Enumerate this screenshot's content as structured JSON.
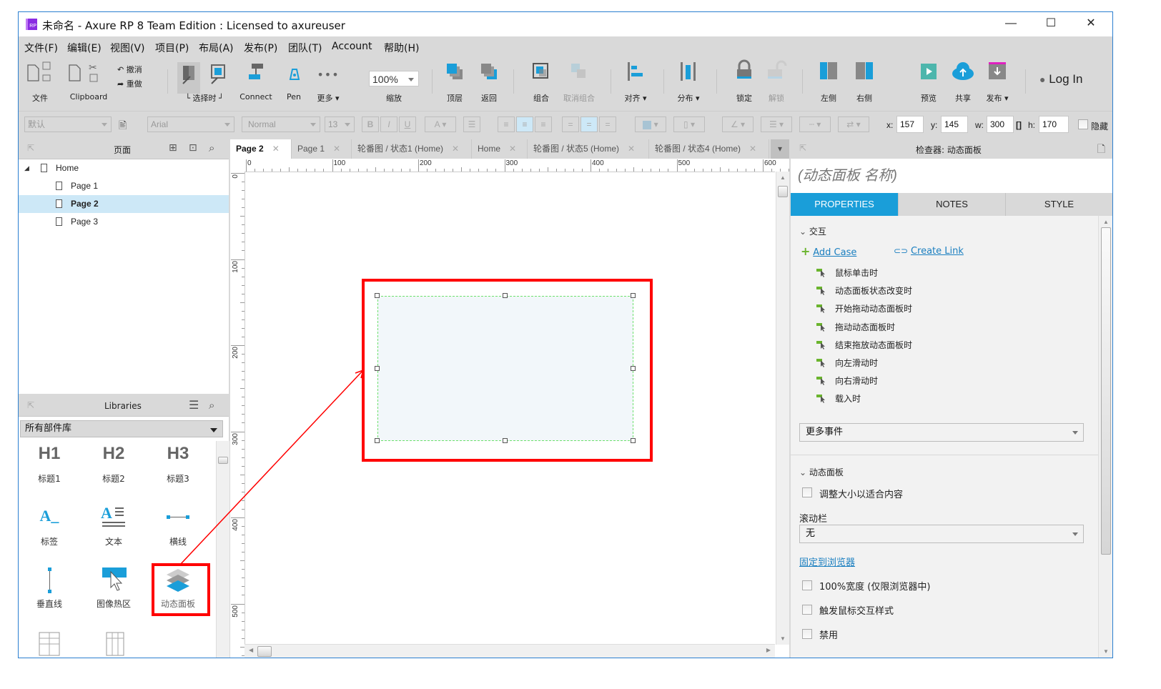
{
  "window": {
    "title": "未命名 - Axure RP 8 Team Edition : Licensed to axureuser",
    "app_icon_text": "RP",
    "controls": [
      "—",
      "☐",
      "✕"
    ]
  },
  "menu": [
    "文件(F)",
    "编辑(E)",
    "视图(V)",
    "项目(P)",
    "布局(A)",
    "发布(P)",
    "团队(T)",
    "Account",
    "帮助(H)"
  ],
  "toolbar": {
    "file_label": "文件",
    "clipboard_label": "Clipboard",
    "undo_label": "撤消",
    "redo_label": "重做",
    "select_mode_label": "└ 选择时 ┘",
    "connect_label": "Connect",
    "pen_label": "Pen",
    "more_label": "更多 ▾",
    "zoom_value": "100%",
    "zoom_label": "缩放",
    "top_label": "顶层",
    "back_label": "返回",
    "group_label": "组合",
    "ungroup_label": "取消组合",
    "align_label": "对齐 ▾",
    "distribute_label": "分布 ▾",
    "lock_label": "锁定",
    "unlock_label": "解锁",
    "left_label": "左侧",
    "right_label": "右侧",
    "preview_label": "预览",
    "share_label": "共享",
    "publish_label": "发布 ▾",
    "login_label": "Log In"
  },
  "format": {
    "style": "默认",
    "font": "Arial",
    "weight": "Normal",
    "size": "13",
    "bold": "B",
    "italic": "I",
    "underline": "U",
    "x_label": "x:",
    "x": "157",
    "y_label": "y:",
    "y": "145",
    "w_label": "w:",
    "w": "300",
    "h_label": "h:",
    "h": "170",
    "hidden_label": "隐藏"
  },
  "pages_panel": {
    "title": "页面",
    "items": [
      {
        "label": "Home"
      },
      {
        "label": "Page 1"
      },
      {
        "label": "Page 2"
      },
      {
        "label": "Page 3"
      }
    ],
    "selected": "Page 2"
  },
  "libraries": {
    "title": "Libraries",
    "selector": "所有部件库",
    "widgets": [
      {
        "glyph": "H1",
        "label": "标题1"
      },
      {
        "glyph": "H2",
        "label": "标题2"
      },
      {
        "glyph": "H3",
        "label": "标题3"
      },
      {
        "glyph": "A_",
        "label": "标签"
      },
      {
        "glyph": "A≡",
        "label": "文本"
      },
      {
        "glyph": "•—•",
        "label": "横线"
      },
      {
        "glyph": "|",
        "label": "垂直线"
      },
      {
        "glyph": "hotspot",
        "label": "图像热区"
      },
      {
        "glyph": "layers",
        "label": "动态面板"
      }
    ]
  },
  "doc_tabs": [
    {
      "label": "Page 2",
      "active": true
    },
    {
      "label": "Page 1"
    },
    {
      "label": "轮番图 / 状态1 (Home)"
    },
    {
      "label": "Home"
    },
    {
      "label": "轮番图 / 状态5 (Home)"
    },
    {
      "label": "轮番图 / 状态4 (Home)"
    }
  ],
  "rulers": {
    "h": [
      "0",
      "100",
      "200",
      "300",
      "400",
      "500",
      "600"
    ],
    "v": [
      "0",
      "100",
      "200",
      "300",
      "400",
      "500"
    ]
  },
  "inspector": {
    "title": "检查器: 动态面板",
    "name_placeholder": "(动态面板 名称)",
    "tabs": [
      "PROPERTIES",
      "NOTES",
      "STYLE"
    ],
    "active_tab": "PROPERTIES",
    "interaction_section": "交互",
    "add_case": "Add Case",
    "create_link": "Create Link",
    "events": [
      "鼠标单击时",
      "动态面板状态改变时",
      "开始拖动动态面板时",
      "拖动动态面板时",
      "结束拖放动态面板时",
      "向左滑动时",
      "向右滑动时",
      "载入时"
    ],
    "more_events": "更多事件",
    "panel_section": "动态面板",
    "fit_content": "调整大小以适合内容",
    "scrollbar_label": "滚动栏",
    "scrollbar_value": "无",
    "pin_to_browser": "固定到浏览器",
    "full_width": "100%宽度 (仅限浏览器中)",
    "mouse_style": "触发鼠标交互样式",
    "disabled": "禁用"
  },
  "colors": {
    "accent": "#1a9ed9",
    "annotation": "#ff0000",
    "selection_dash": "#6de06d",
    "panel_fill": "#f2f7fa",
    "event_icon": "#6ab42d"
  }
}
